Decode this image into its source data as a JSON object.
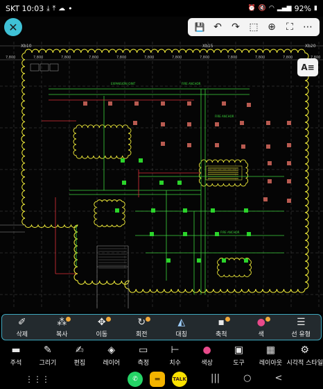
{
  "status_bar": {
    "carrier_time": "SKT 10:03",
    "notification_icons": [
      "download-icon",
      "upload-icon",
      "cloud-icon"
    ],
    "dot": "•",
    "battery": "92%",
    "system_icons": [
      "alarm-icon",
      "mute-icon",
      "wifi-icon",
      "signal-icon"
    ]
  },
  "toolbar": {
    "close_glyph": "✕",
    "save_glyph": "💾",
    "undo_glyph": "↶",
    "redo_glyph": "↷",
    "select_glyph": "⬚",
    "zoom_glyph": "⊕",
    "fullscreen_glyph": "⛶",
    "more_glyph": "⋯",
    "layer_glyph": "A≡"
  },
  "drawing": {
    "grid_labels": [
      "Xb10",
      "Xb15",
      "Xb20"
    ],
    "dimension_values": [
      "7,800",
      "7,800",
      "7,800",
      "7,800",
      "7,800",
      "7,800",
      "7,800",
      "7,800",
      "7,800",
      "7,800",
      "7,800",
      "7,800"
    ],
    "annotations": [
      "FIRE ANCHOR",
      "EXPANSION JOINT",
      "FIRE ANCHOR",
      "FIRE ANCHOR"
    ],
    "colors": {
      "boundary": "#f5f03a",
      "pipe": "#3cd43c",
      "red_line": "#e0303a",
      "grid": "#4a4a4a",
      "fixture": "#b85a50",
      "equipment": "#2bd42b"
    }
  },
  "edit_toolbar": {
    "items": [
      {
        "label": "삭제",
        "icon": "eraser-icon",
        "glyph": "✐",
        "badge": false
      },
      {
        "label": "복사",
        "icon": "copy-icon",
        "glyph": "⁂",
        "badge": true
      },
      {
        "label": "이동",
        "icon": "move-icon",
        "glyph": "✥",
        "badge": true
      },
      {
        "label": "회전",
        "icon": "rotate-icon",
        "glyph": "↻",
        "badge": true
      },
      {
        "label": "대칭",
        "icon": "mirror-icon",
        "glyph": "◭",
        "badge": false
      },
      {
        "label": "축척",
        "icon": "scale-icon",
        "glyph": "▪",
        "badge": true
      },
      {
        "label": "색",
        "icon": "color-icon",
        "glyph": "●",
        "badge": true
      },
      {
        "label": "선 유형",
        "icon": "linetype-icon",
        "glyph": "☰",
        "badge": false
      }
    ]
  },
  "main_menu": {
    "items": [
      {
        "label": "주석",
        "icon": "comment-icon",
        "glyph": "▬"
      },
      {
        "label": "그리기",
        "icon": "pencil-icon",
        "glyph": "✎"
      },
      {
        "label": "편집",
        "icon": "edit-icon",
        "glyph": "✍"
      },
      {
        "label": "레이어",
        "icon": "layers-icon",
        "glyph": "◈"
      },
      {
        "label": "측정",
        "icon": "ruler-icon",
        "glyph": "▭"
      },
      {
        "label": "치수",
        "icon": "dimension-icon",
        "glyph": "⊢"
      },
      {
        "label": "색상",
        "icon": "palette-icon",
        "glyph": "●"
      },
      {
        "label": "도구",
        "icon": "toolbox-icon",
        "glyph": "▣"
      },
      {
        "label": "레이아웃",
        "icon": "layout-icon",
        "glyph": "▦"
      },
      {
        "label": "시각적 스타일",
        "icon": "visual-style-icon",
        "glyph": "⚙"
      }
    ]
  },
  "nav_bar": {
    "grid_glyph": "⋮⋮⋮",
    "apps": [
      {
        "name": "whatsapp-icon",
        "glyph": "✆",
        "bg": "#25d366",
        "fg": "#fff"
      },
      {
        "name": "files-icon",
        "glyph": "▬",
        "bg": "#f4b400",
        "fg": "#7a5400"
      },
      {
        "name": "kakaotalk-icon",
        "glyph": "TALK",
        "bg": "#fae100",
        "fg": "#3c1e1e"
      }
    ],
    "keys": [
      "|||",
      "○",
      "<"
    ]
  }
}
